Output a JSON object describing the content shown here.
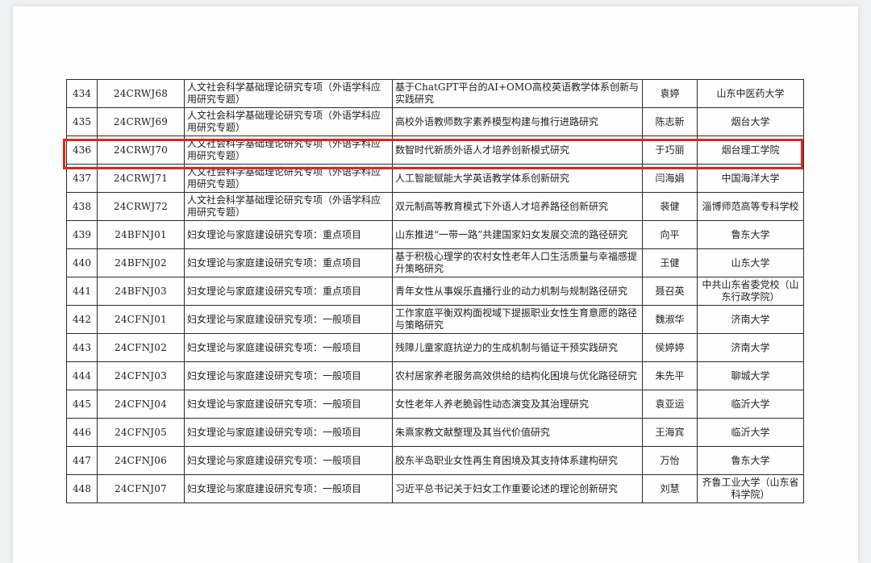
{
  "table": {
    "rows": [
      {
        "num": "434",
        "code": "24CRWJ68",
        "type": "人文社会科学基础理论研究专项（外语学科应用研究专题）",
        "title": "基于ChatGPT平台的AI+OMO高校英语教学体系创新与实践研究",
        "leader": "袁婷",
        "institution": "山东中医药大学"
      },
      {
        "num": "435",
        "code": "24CRWJ69",
        "type": "人文社会科学基础理论研究专项（外语学科应用研究专题）",
        "title": "高校外语教师数字素养模型构建与推行进路研究",
        "leader": "陈志新",
        "institution": "烟台大学"
      },
      {
        "num": "436",
        "code": "24CRWJ70",
        "type": "人文社会科学基础理论研究专项（外语学科应用研究专题）",
        "title": "数智时代新质外语人才培养创新模式研究",
        "leader": "于巧丽",
        "institution": "烟台理工学院"
      },
      {
        "num": "437",
        "code": "24CRWJ71",
        "type": "人文社会科学基础理论研究专项（外语学科应用研究专题）",
        "title": "人工智能赋能大学英语教学体系创新研究",
        "leader": "闫海娟",
        "institution": "中国海洋大学"
      },
      {
        "num": "438",
        "code": "24CRWJ72",
        "type": "人文社会科学基础理论研究专项（外语学科应用研究专题）",
        "title": "双元制高等教育模式下外语人才培养路径创新研究",
        "leader": "裴健",
        "institution": "淄博师范高等专科学校"
      },
      {
        "num": "439",
        "code": "24BFNJ01",
        "type": "妇女理论与家庭建设研究专项：重点项目",
        "title": "山东推进“一带一路”共建国家妇女发展交流的路径研究",
        "leader": "向平",
        "institution": "鲁东大学"
      },
      {
        "num": "440",
        "code": "24BFNJ02",
        "type": "妇女理论与家庭建设研究专项：重点项目",
        "title": "基于积极心理学的农村女性老年人口生活质量与幸福感提升策略研究",
        "leader": "王健",
        "institution": "山东大学"
      },
      {
        "num": "441",
        "code": "24BFNJ03",
        "type": "妇女理论与家庭建设研究专项：重点项目",
        "title": "青年女性从事娱乐直播行业的动力机制与规制路径研究",
        "leader": "聂召英",
        "institution": "中共山东省委党校（山东行政学院）"
      },
      {
        "num": "442",
        "code": "24CFNJ01",
        "type": "妇女理论与家庭建设研究专项：一般项目",
        "title": "工作家庭平衡双构面视域下提振职业女性生育意愿的路径与策略研究",
        "leader": "魏淑华",
        "institution": "济南大学"
      },
      {
        "num": "443",
        "code": "24CFNJ02",
        "type": "妇女理论与家庭建设研究专项：一般项目",
        "title": "残障儿童家庭抗逆力的生成机制与循证干预实践研究",
        "leader": "侯婷婷",
        "institution": "济南大学"
      },
      {
        "num": "444",
        "code": "24CFNJ03",
        "type": "妇女理论与家庭建设研究专项：一般项目",
        "title": "农村居家养老服务高效供给的结构化困境与优化路径研究",
        "leader": "朱先平",
        "institution": "聊城大学"
      },
      {
        "num": "445",
        "code": "24CFNJ04",
        "type": "妇女理论与家庭建设研究专项：一般项目",
        "title": "女性老年人养老脆弱性动态演变及其治理研究",
        "leader": "袁亚运",
        "institution": "临沂大学"
      },
      {
        "num": "446",
        "code": "24CFNJ05",
        "type": "妇女理论与家庭建设研究专项：一般项目",
        "title": "朱熹家教文献整理及其当代价值研究",
        "leader": "王海宾",
        "institution": "临沂大学"
      },
      {
        "num": "447",
        "code": "24CFNJ06",
        "type": "妇女理论与家庭建设研究专项：一般项目",
        "title": "胶东半岛职业女性再生育困境及其支持体系建构研究",
        "leader": "万怡",
        "institution": "鲁东大学"
      },
      {
        "num": "448",
        "code": "24CFNJ07",
        "type": "妇女理论与家庭建设研究专项：一般项目",
        "title": "习近平总书记关于妇女工作重要论述的理论创新研究",
        "leader": "刘慧",
        "institution": "齐鲁工业大学（山东省科学院）"
      }
    ]
  },
  "highlight": {
    "color": "#e0261d"
  }
}
